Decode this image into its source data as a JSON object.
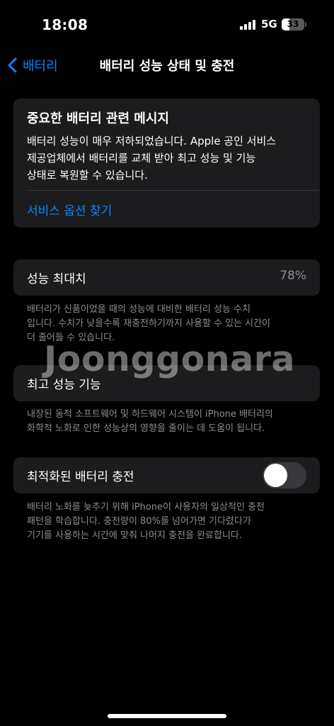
{
  "status_bar": {
    "time": "18:08",
    "network": "5G",
    "battery_level": "33",
    "battery_fraction": 0.33
  },
  "nav": {
    "back_label": "배터리",
    "title": "배터리 성능 상태 및 충전"
  },
  "message": {
    "title": "중요한 배터리 관련 메시지",
    "body": [
      "배터리 성능이 매우 저하되었습니다. Apple 공인 서비스",
      "제공업체에서 배터리를 교체 받아 최고 성능 및 기능",
      "상태로 복원할 수 있습니다."
    ],
    "link": "서비스 옵션 찾기"
  },
  "max_capacity": {
    "label": "성능 최대치",
    "value": "78%",
    "footnote": [
      "배터리가 신품이었을 때의 성능에 대비한 배터리 성능 수치",
      "입니다. 수치가 낮을수록 재충전하기까지 사용할 수 있는 시간이",
      "더 줄어들 수 있습니다."
    ]
  },
  "peak_performance": {
    "label": "최고 성능 기능",
    "footnote": [
      "내장된 동적 소프트웨어 및 하드웨어 시스템이 iPhone 배터리의",
      "화학적 노화로 인한 성능상의 영향을 줄이는 데 도움이 됩니다."
    ]
  },
  "optimized_charging": {
    "label": "최적화된 배터리 충전",
    "enabled": false,
    "footnote": [
      "배터리 노화를 늦추기 위해 iPhone이 사용자의 일상적인 충전",
      "패턴을 학습합니다. 충전량이 80%를 넘어가면 기다렸다가",
      "기기를 사용하는 시간에 맞춰 나머지 충전을 완료합니다."
    ]
  },
  "watermark": "Joonggonara",
  "colors": {
    "accent": "#0a84ff",
    "card": "#1c1c1e",
    "secondary_text": "#8e8e93",
    "toggle_off": "#39393d"
  }
}
